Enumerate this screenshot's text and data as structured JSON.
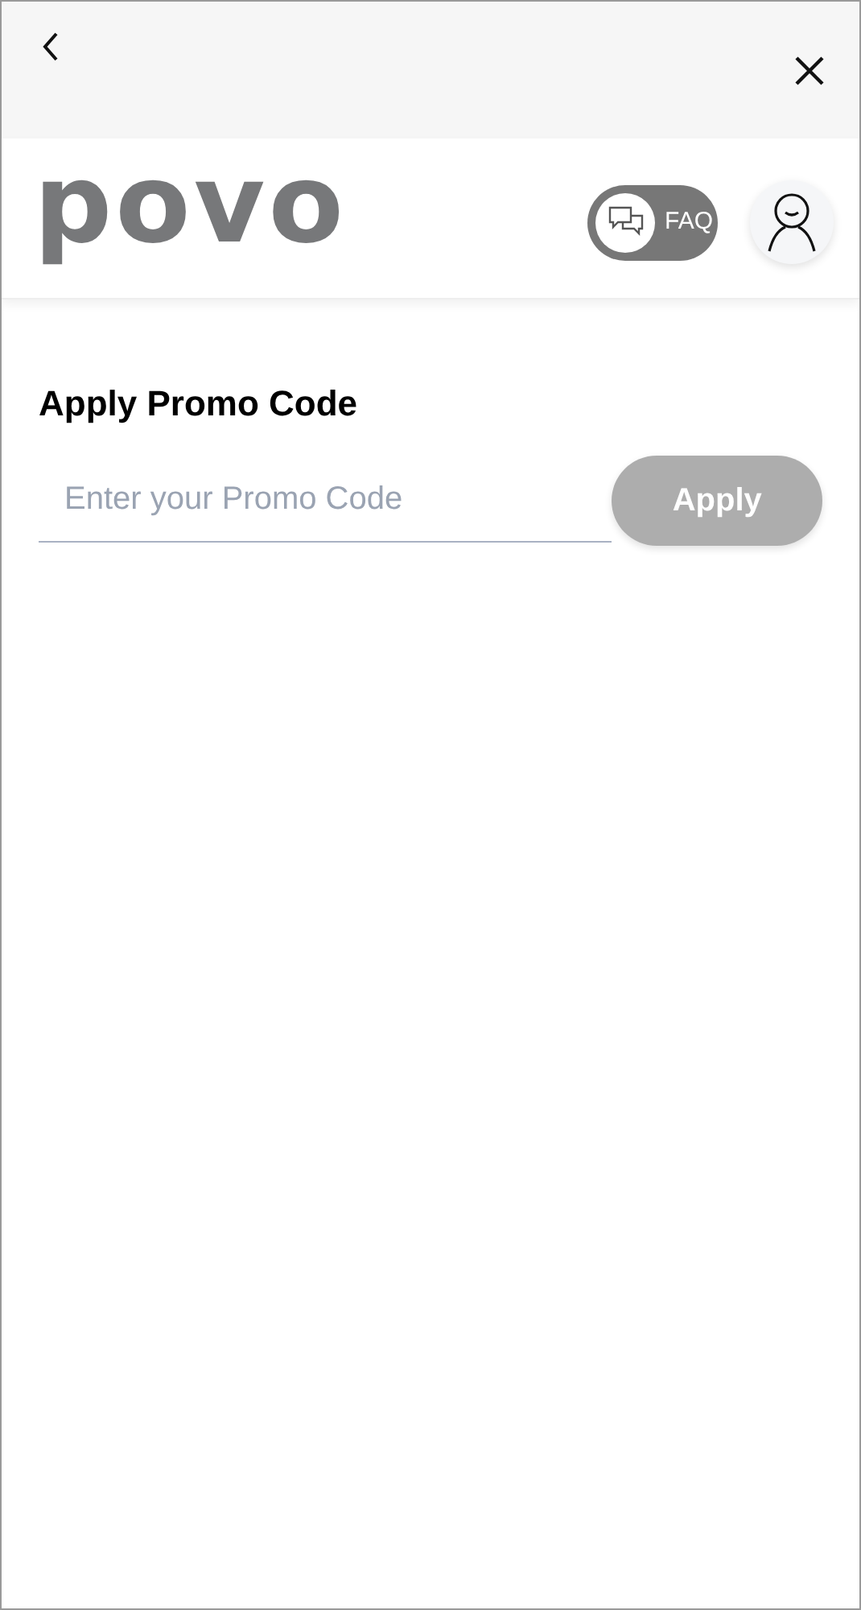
{
  "header": {
    "logo": "povo",
    "faq_label": "FAQ"
  },
  "promo": {
    "title": "Apply Promo Code",
    "placeholder": "Enter your Promo Code",
    "button": {
      "label": "Apply",
      "disabled": true
    }
  }
}
